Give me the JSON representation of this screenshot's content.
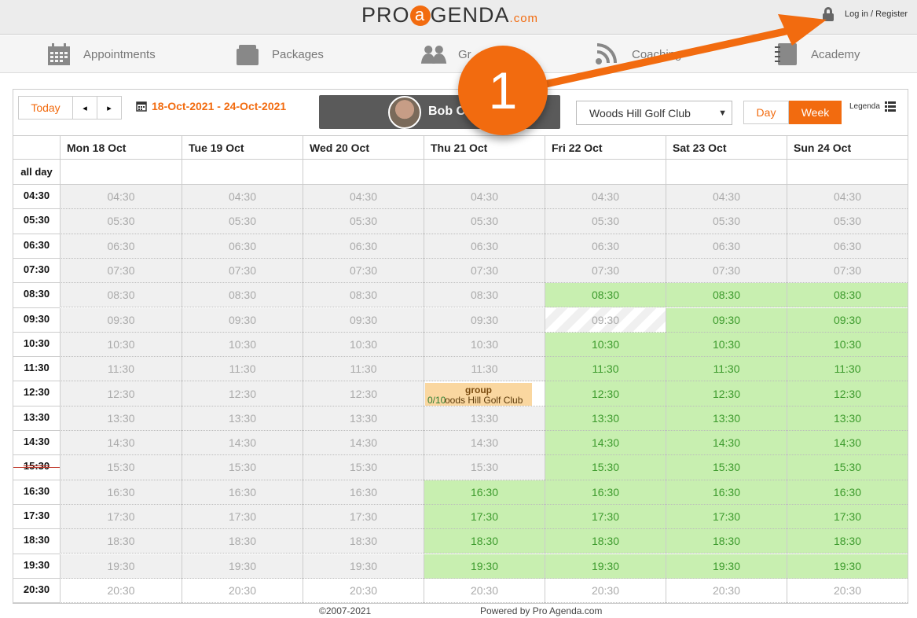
{
  "header": {
    "logo_pre": "PRO",
    "logo_a": "a",
    "logo_post": "GENDA",
    "logo_com": ".com",
    "login_label": "Log in / Register"
  },
  "nav": {
    "items": [
      {
        "label": "Appointments",
        "icon": "calendar-icon"
      },
      {
        "label": "Packages",
        "icon": "package-icon"
      },
      {
        "label": "Gr",
        "icon": "group-icon"
      },
      {
        "label": "Coaching",
        "icon": "coaching-icon"
      },
      {
        "label": "Academy",
        "icon": "notebook-icon"
      }
    ]
  },
  "toolbar": {
    "today_label": "Today",
    "prev_label": "◂",
    "next_label": "▸",
    "date_range": "18-Oct-2021 - 24-Oct-2021",
    "coach_name": "Bob Cl",
    "club_select": "Woods Hill Golf Club",
    "view_day": "Day",
    "view_week": "Week",
    "legenda": "Legenda"
  },
  "days": [
    "Mon 18 Oct",
    "Tue 19 Oct",
    "Wed 20 Oct",
    "Thu 21 Oct",
    "Fri 22 Oct",
    "Sat 23 Oct",
    "Sun 24 Oct"
  ],
  "all_day_label": "all day",
  "times": [
    "04:30",
    "05:30",
    "06:30",
    "07:30",
    "08:30",
    "09:30",
    "10:30",
    "11:30",
    "12:30",
    "13:30",
    "14:30",
    "15:30",
    "16:30",
    "17:30",
    "18:30",
    "19:30",
    "20:30"
  ],
  "event": {
    "title": "group",
    "count": "0/10",
    "location": "oods Hill Golf Club"
  },
  "footer": {
    "copyright": "©2007-2021",
    "powered": "Powered by Pro Agenda.com"
  },
  "annotation": {
    "badge": "1",
    "color": "#f26b0f"
  }
}
